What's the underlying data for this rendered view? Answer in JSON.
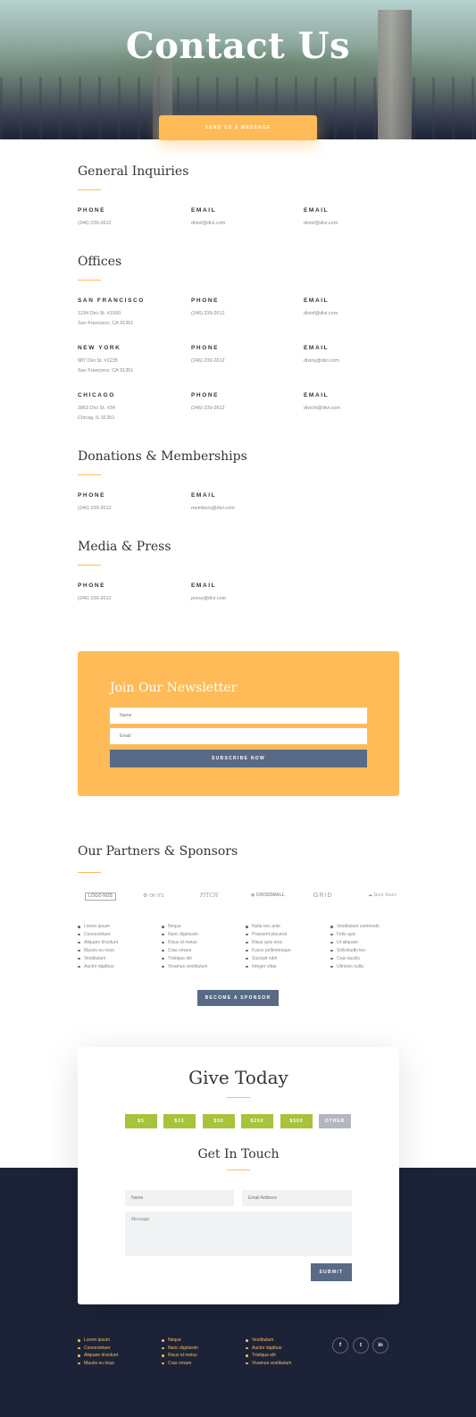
{
  "hero": {
    "title": "Contact Us",
    "button_label": "SEND US A MESSAGE"
  },
  "general": {
    "heading": "General Inquiries",
    "cols": [
      {
        "label": "PHONE",
        "lines": [
          "(246) 239-2612"
        ]
      },
      {
        "label": "EMAIL",
        "lines": [
          "divisf@divi.com"
        ]
      },
      {
        "label": "EMAIL",
        "lines": [
          "divisf@divi.com"
        ]
      }
    ]
  },
  "offices": {
    "heading": "Offices",
    "rows": [
      {
        "city": "SAN FRANCISCO",
        "address": [
          "1234 Divi St. #1000",
          "San Francisco, CA 91351"
        ],
        "phone_label": "PHONE",
        "phone": "(246) 239-2612",
        "email_label": "EMAIL",
        "email": "divisf@divi.com"
      },
      {
        "city": "NEW YORK",
        "address": [
          "987 Divi St. #1235",
          "San Francisco, CA 91351"
        ],
        "phone_label": "PHONE",
        "phone": "(246) 239-2612",
        "email_label": "EMAIL",
        "email": "diviny@divi.com"
      },
      {
        "city": "CHICAGO",
        "address": [
          "2863 Divi St. #34",
          "Chicag, IL 91351"
        ],
        "phone_label": "PHONE",
        "phone": "(246) 239-2612",
        "email_label": "EMAIL",
        "email": "divichi@divi.com"
      }
    ]
  },
  "donations": {
    "heading": "Donations & Memberships",
    "cols": [
      {
        "label": "PHONE",
        "value": "(246) 239-2612"
      },
      {
        "label": "EMAIL",
        "value": "members@divi.com"
      }
    ]
  },
  "media": {
    "heading": "Media & Press",
    "cols": [
      {
        "label": "PHONE",
        "value": "(246) 239-2612"
      },
      {
        "label": "EMAIL",
        "value": "press@divi.com"
      }
    ]
  },
  "newsletter": {
    "title": "Join Our Newsletter",
    "name_placeholder": "Name",
    "email_placeholder": "Email",
    "button_label": "SUBSCRIBE NOW"
  },
  "partners": {
    "heading": "Our Partners & Sponsors",
    "logos": [
      "LOGO NOS",
      "OK ITS",
      "PITCH",
      "CROSSWALL",
      "GRID",
      "Bird Ware"
    ],
    "lists": [
      [
        "Lorem ipsum",
        "Consectetuer",
        "Aliquam tincidunt",
        "Mauris eu risus",
        "Vestibulum",
        "Auctor dapibus"
      ],
      [
        "Neque",
        "Nunc dignissim",
        "Risus id metus",
        "Cras ornare",
        "Tristique elit",
        "Vivamus vestibulum"
      ],
      [
        "Nulla nec ante",
        "Praesent placerat",
        "Risus quis eros",
        "Fusce pellentesque",
        "Suscipit nibh",
        "Integer vitae"
      ],
      [
        "Vestibulum commodo",
        "Felis quis",
        "Ut aliquam",
        "Sollicitudin leo",
        "Cras iaculis",
        "Ultricies nulla"
      ]
    ],
    "button_label": "BECOME A SPONSOR"
  },
  "donate": {
    "title": "Give Today",
    "amounts": [
      "$5",
      "$10",
      "$50",
      "$250",
      "$500",
      "OTHER"
    ],
    "contact_title": "Get In Touch",
    "name_placeholder": "Name",
    "email_placeholder": "Email Address",
    "message_placeholder": "Message",
    "submit_label": "SUBMIT"
  },
  "footer": {
    "lists": [
      [
        "Lorem ipsum",
        "Consectetuer",
        "Aliquam tincidunt",
        "Mauris eu risus"
      ],
      [
        "Neque",
        "Nunc dignissim",
        "Risus id metus",
        "Cras ornare"
      ],
      [
        "Vestibulum",
        "Auctor dapibus",
        "Tristique elit",
        "Vivamus vestibulum"
      ]
    ],
    "social": [
      {
        "icon": "facebook-icon",
        "glyph": "f"
      },
      {
        "icon": "twitter-icon",
        "glyph": "t"
      },
      {
        "icon": "linkedin-icon",
        "glyph": "in"
      }
    ]
  },
  "colors": {
    "accent": "#ffbb58",
    "button": "#586a85",
    "donate": "#a7c33c",
    "footer": "#1c2338"
  }
}
